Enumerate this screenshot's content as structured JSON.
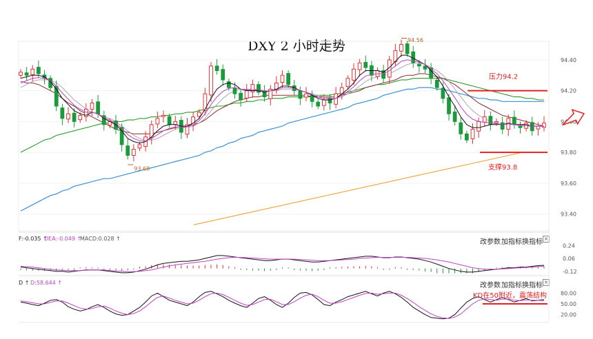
{
  "chart_data": {
    "type": "line",
    "title": "DXY 2 小时走势",
    "main_panel": {
      "yticks": [
        "94.40",
        "94.20",
        "94.00",
        "93.80",
        "93.60",
        "93.40"
      ],
      "ylim": [
        93.3,
        94.52
      ],
      "price_close": [
        94.32,
        94.3,
        94.34,
        94.31,
        94.28,
        94.22,
        94.1,
        94.02,
        94.05,
        94.0,
        94.04,
        94.08,
        94.12,
        94.05,
        93.98,
        94.0,
        93.95,
        93.85,
        93.78,
        93.82,
        93.85,
        93.9,
        93.98,
        94.02,
        94.04,
        93.98,
        94.0,
        93.93,
        93.98,
        94.03,
        94.06,
        94.18,
        94.36,
        94.33,
        94.27,
        94.22,
        94.18,
        94.14,
        94.2,
        94.24,
        94.19,
        94.16,
        94.21,
        94.25,
        94.3,
        94.24,
        94.2,
        94.15,
        94.18,
        94.13,
        94.1,
        94.14,
        94.12,
        94.18,
        94.22,
        94.28,
        94.34,
        94.38,
        94.35,
        94.3,
        94.33,
        94.28,
        94.4,
        94.46,
        94.5,
        94.44,
        94.38,
        94.36,
        94.34,
        94.28,
        94.22,
        94.15,
        94.05,
        94.0,
        93.92,
        93.88,
        93.95,
        94.0,
        94.03,
        93.98,
        94.0,
        93.95,
        94.02,
        93.98,
        93.96,
        93.99,
        93.94,
        93.97,
        93.99
      ],
      "ma_fast": [
        94.28,
        94.29,
        94.3,
        94.3,
        94.29,
        94.26,
        94.21,
        94.15,
        94.11,
        94.07,
        94.05,
        94.04,
        94.06,
        94.05,
        94.02,
        94.0,
        93.98,
        93.94,
        93.89,
        93.87,
        93.86,
        93.87,
        93.9,
        93.94,
        93.97,
        93.98,
        93.98,
        93.97,
        93.97,
        93.99,
        94.02,
        94.08,
        94.15,
        94.21,
        94.24,
        94.25,
        94.24,
        94.21,
        94.2,
        94.2,
        94.2,
        94.19,
        94.2,
        94.21,
        94.23,
        94.23,
        94.22,
        94.2,
        94.19,
        94.17,
        94.15,
        94.14,
        94.14,
        94.15,
        94.18,
        94.21,
        94.25,
        94.3,
        94.33,
        94.33,
        94.33,
        94.32,
        94.35,
        94.39,
        94.43,
        94.43,
        94.41,
        94.39,
        94.37,
        94.33,
        94.29,
        94.23,
        94.16,
        94.1,
        94.03,
        93.98,
        93.96,
        93.96,
        93.97,
        93.98,
        93.98,
        93.98,
        93.99,
        93.98,
        93.98,
        93.98,
        93.97,
        93.97,
        93.97
      ],
      "ma_mid": [
        94.22,
        94.24,
        94.26,
        94.27,
        94.27,
        94.27,
        94.25,
        94.22,
        94.18,
        94.14,
        94.11,
        94.08,
        94.06,
        94.05,
        94.03,
        94.02,
        94.0,
        93.97,
        93.94,
        93.91,
        93.89,
        93.88,
        93.88,
        93.89,
        93.91,
        93.93,
        93.95,
        93.96,
        93.96,
        93.97,
        93.99,
        94.02,
        94.07,
        94.11,
        94.15,
        94.18,
        94.2,
        94.21,
        94.21,
        94.21,
        94.21,
        94.2,
        94.2,
        94.2,
        94.21,
        94.21,
        94.21,
        94.2,
        94.19,
        94.18,
        94.17,
        94.16,
        94.15,
        94.15,
        94.16,
        94.18,
        94.2,
        94.23,
        94.26,
        94.28,
        94.29,
        94.3,
        94.31,
        94.33,
        94.35,
        94.37,
        94.38,
        94.38,
        94.37,
        94.35,
        94.33,
        94.3,
        94.26,
        94.21,
        94.16,
        94.11,
        94.07,
        94.04,
        94.02,
        94.0,
        93.99,
        93.98,
        93.98,
        93.98,
        93.97,
        93.97,
        93.97,
        93.97,
        93.97
      ],
      "ma_slow": [
        94.26,
        94.25,
        94.25,
        94.24,
        94.22,
        94.2,
        94.18,
        94.15,
        94.12,
        94.1,
        94.07,
        94.05,
        94.03,
        94.01,
        93.99,
        93.97,
        93.95,
        93.94,
        93.93,
        93.92,
        93.92,
        93.92,
        93.92,
        93.93,
        93.94,
        93.95,
        93.96,
        93.97,
        93.97,
        93.98,
        93.99,
        94.01,
        94.04,
        94.07,
        94.09,
        94.11,
        94.13,
        94.14,
        94.15,
        94.16,
        94.16,
        94.17,
        94.17,
        94.17,
        94.17,
        94.17,
        94.17,
        94.17,
        94.17,
        94.16,
        94.16,
        94.16,
        94.16,
        94.16,
        94.17,
        94.18,
        94.19,
        94.2,
        94.22,
        94.23,
        94.24,
        94.25,
        94.26,
        94.27,
        94.29,
        94.3,
        94.3,
        94.31,
        94.31,
        94.3,
        94.29,
        94.28,
        94.26,
        94.24,
        94.21,
        94.18,
        94.15,
        94.12,
        94.1,
        94.08,
        94.06,
        94.04,
        94.03,
        94.02,
        94.01,
        94.0,
        93.99,
        93.98,
        93.97
      ],
      "ma_green": [
        93.8,
        93.82,
        93.84,
        93.86,
        93.88,
        93.89,
        93.91,
        93.92,
        93.93,
        93.94,
        93.95,
        93.96,
        93.97,
        93.98,
        93.99,
        93.99,
        94.0,
        94.0,
        94.01,
        94.01,
        94.02,
        94.02,
        94.03,
        94.03,
        94.04,
        94.04,
        94.05,
        94.05,
        94.06,
        94.06,
        94.07,
        94.08,
        94.09,
        94.1,
        94.1,
        94.11,
        94.12,
        94.12,
        94.13,
        94.13,
        94.14,
        94.14,
        94.15,
        94.15,
        94.15,
        94.16,
        94.16,
        94.16,
        94.16,
        94.16,
        94.17,
        94.17,
        94.17,
        94.18,
        94.18,
        94.19,
        94.2,
        94.21,
        94.22,
        94.23,
        94.24,
        94.24,
        94.25,
        94.26,
        94.27,
        94.27,
        94.28,
        94.28,
        94.28,
        94.28,
        94.28,
        94.28,
        94.27,
        94.26,
        94.25,
        94.24,
        94.23,
        94.22,
        94.21,
        94.2,
        94.19,
        94.18,
        94.17,
        94.16,
        94.16,
        94.15,
        94.15,
        94.14,
        94.14
      ],
      "ma_blue": [
        93.42,
        93.44,
        93.46,
        93.48,
        93.5,
        93.52,
        93.53,
        93.55,
        93.56,
        93.58,
        93.59,
        93.6,
        93.61,
        93.62,
        93.63,
        93.63,
        93.64,
        93.65,
        93.66,
        93.67,
        93.68,
        93.69,
        93.7,
        93.71,
        93.72,
        93.73,
        93.74,
        93.75,
        93.76,
        93.77,
        93.78,
        93.8,
        93.81,
        93.83,
        93.84,
        93.86,
        93.87,
        93.89,
        93.9,
        93.91,
        93.93,
        93.94,
        93.95,
        93.96,
        93.97,
        93.99,
        94.0,
        94.01,
        94.02,
        94.03,
        94.04,
        94.05,
        94.06,
        94.07,
        94.08,
        94.09,
        94.11,
        94.12,
        94.13,
        94.14,
        94.15,
        94.17,
        94.18,
        94.19,
        94.2,
        94.21,
        94.21,
        94.22,
        94.22,
        94.22,
        94.21,
        94.21,
        94.2,
        94.19,
        94.18,
        94.17,
        94.16,
        94.15,
        94.15,
        94.14,
        94.14,
        94.13,
        94.13,
        94.13,
        94.13,
        94.13,
        94.13,
        94.13,
        94.13
      ],
      "ma_orange": [
        [
          0.33,
          93.33
        ],
        [
          0.95,
          93.8
        ]
      ],
      "annotations": {
        "low": "93.68",
        "high": "94.56",
        "resistance": "压力94.2",
        "support": "支撑93.8",
        "resistance_level": 94.2,
        "support_level": 93.8
      },
      "colors": {
        "up": "#e03030",
        "down": "#1a9a3a",
        "black": "#111111",
        "magenta": "#c040c0",
        "gray": "#aaaaaa",
        "darkred": "#8b2a2a",
        "green": "#2a9a2a",
        "blue": "#3a90d8",
        "orange": "#f0a030",
        "red": "#e02020"
      }
    },
    "macd_panel": {
      "legend": [
        "F:-0.035 ↑",
        "DEA:-0.049 ↑",
        "MACD:0.028 ↑"
      ],
      "yticks": [
        "0.24",
        "0.06",
        "-0.12"
      ],
      "ylim": [
        -0.16,
        0.3
      ],
      "dif": [
        -0.06,
        -0.07,
        -0.08,
        -0.09,
        -0.1,
        -0.11,
        -0.12,
        -0.12,
        -0.13,
        -0.12,
        -0.11,
        -0.1,
        -0.1,
        -0.1,
        -0.11,
        -0.12,
        -0.13,
        -0.14,
        -0.14,
        -0.13,
        -0.11,
        -0.09,
        -0.06,
        -0.03,
        -0.01,
        0.0,
        0.01,
        0.02,
        0.02,
        0.03,
        0.04,
        0.06,
        0.08,
        0.1,
        0.1,
        0.09,
        0.08,
        0.07,
        0.06,
        0.05,
        0.04,
        0.03,
        0.03,
        0.04,
        0.05,
        0.05,
        0.04,
        0.03,
        0.02,
        0.01,
        0.01,
        0.02,
        0.03,
        0.04,
        0.05,
        0.06,
        0.07,
        0.08,
        0.09,
        0.09,
        0.08,
        0.07,
        0.07,
        0.08,
        0.08,
        0.07,
        0.06,
        0.05,
        0.03,
        0.01,
        -0.02,
        -0.05,
        -0.08,
        -0.1,
        -0.12,
        -0.13,
        -0.13,
        -0.12,
        -0.11,
        -0.1,
        -0.09,
        -0.08,
        -0.07,
        -0.07,
        -0.06,
        -0.06,
        -0.05,
        -0.04,
        -0.035
      ],
      "dea": [
        -0.05,
        -0.055,
        -0.06,
        -0.07,
        -0.08,
        -0.09,
        -0.1,
        -0.105,
        -0.11,
        -0.11,
        -0.11,
        -0.105,
        -0.1,
        -0.1,
        -0.1,
        -0.11,
        -0.115,
        -0.12,
        -0.125,
        -0.125,
        -0.12,
        -0.11,
        -0.1,
        -0.08,
        -0.06,
        -0.045,
        -0.03,
        -0.02,
        -0.01,
        0.0,
        0.01,
        0.02,
        0.035,
        0.05,
        0.06,
        0.07,
        0.075,
        0.075,
        0.07,
        0.065,
        0.06,
        0.055,
        0.05,
        0.05,
        0.05,
        0.05,
        0.05,
        0.045,
        0.04,
        0.035,
        0.03,
        0.03,
        0.03,
        0.035,
        0.04,
        0.045,
        0.05,
        0.06,
        0.065,
        0.07,
        0.075,
        0.075,
        0.075,
        0.075,
        0.075,
        0.075,
        0.07,
        0.065,
        0.06,
        0.05,
        0.04,
        0.025,
        0.01,
        -0.01,
        -0.03,
        -0.05,
        -0.07,
        -0.08,
        -0.09,
        -0.09,
        -0.09,
        -0.085,
        -0.08,
        -0.075,
        -0.07,
        -0.065,
        -0.06,
        -0.055,
        -0.049
      ],
      "bar_up_color": "#e03030",
      "bar_down_color": "#1a9a3a"
    },
    "kd_panel": {
      "legend": [
        "D ↑",
        "D:58.644 ↑"
      ],
      "yticks": [
        "80.00",
        "50.00",
        "20.00"
      ],
      "ylim": [
        0,
        100
      ],
      "k": [
        55,
        52,
        48,
        45,
        52,
        60,
        62,
        55,
        42,
        35,
        30,
        34,
        42,
        48,
        40,
        30,
        22,
        18,
        20,
        30,
        40,
        55,
        72,
        80,
        70,
        60,
        55,
        50,
        45,
        55,
        70,
        82,
        85,
        78,
        70,
        60,
        52,
        45,
        40,
        52,
        65,
        70,
        60,
        48,
        40,
        52,
        68,
        80,
        82,
        75,
        62,
        48,
        45,
        55,
        62,
        70,
        75,
        80,
        85,
        78,
        72,
        80,
        85,
        78,
        68,
        55,
        40,
        30,
        20,
        12,
        10,
        8,
        10,
        20,
        38,
        55,
        65,
        70,
        62,
        55,
        62,
        68,
        62,
        55,
        60,
        65,
        58,
        60,
        62
      ],
      "d": [
        58,
        56,
        53,
        50,
        50,
        54,
        58,
        58,
        52,
        45,
        38,
        35,
        37,
        42,
        44,
        38,
        30,
        24,
        20,
        23,
        30,
        42,
        56,
        68,
        72,
        66,
        60,
        55,
        50,
        52,
        60,
        70,
        78,
        80,
        76,
        68,
        60,
        52,
        46,
        48,
        55,
        62,
        63,
        56,
        48,
        48,
        56,
        66,
        74,
        77,
        70,
        60,
        52,
        52,
        56,
        62,
        68,
        74,
        79,
        80,
        77,
        78,
        80,
        80,
        74,
        65,
        54,
        42,
        32,
        22,
        15,
        11,
        9,
        13,
        22,
        36,
        50,
        60,
        64,
        62,
        60,
        63,
        64,
        60,
        59,
        61,
        60,
        60,
        58.6
      ],
      "annotation": "KD在50附近，震荡结构",
      "annotation_level": 50
    }
  },
  "toolbar": {
    "change_params": "改参数",
    "add_indicator": "加指标",
    "swap_indicator": "换指标",
    "close": "×"
  }
}
